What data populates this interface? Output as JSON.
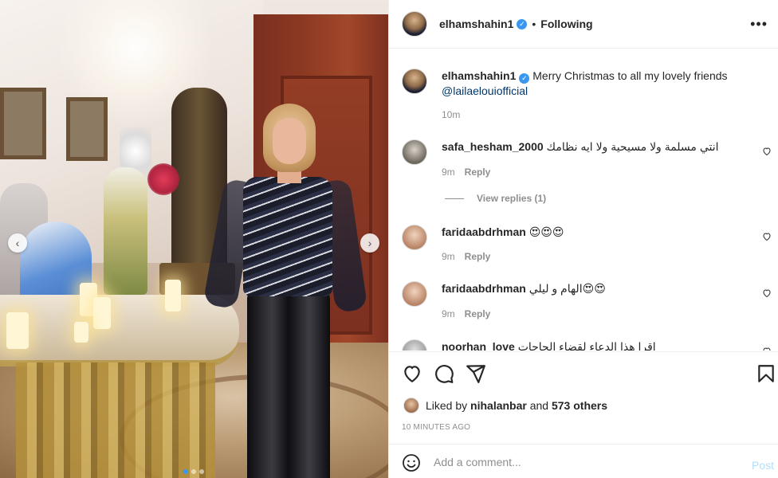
{
  "media": {
    "prev_glyph": "‹",
    "next_glyph": "›",
    "carousel_dots": 3,
    "active_dot": 1
  },
  "header": {
    "username": "elhamshahin1",
    "verified_glyph": "✓",
    "separator": "•",
    "follow_status": "Following",
    "more_glyph": "•••"
  },
  "caption": {
    "username": "elhamshahin1",
    "text": "Merry Christmas to all my lovely friends",
    "mention": "@lailaelouiofficial",
    "time": "10m"
  },
  "comments": [
    {
      "username": "safa_hesham_2000",
      "text": "انتي مسلمة ولا مسيحية ولا ايه نظامك",
      "time": "9m",
      "reply_label": "Reply",
      "view_replies": "View replies (1)"
    },
    {
      "username": "faridaabdrhman",
      "text": "😍😍😍",
      "time": "9m",
      "reply_label": "Reply"
    },
    {
      "username": "faridaabdrhman",
      "text": "الهام و ليلي😍😍",
      "time": "9m",
      "reply_label": "Reply"
    },
    {
      "username": "noorhan_love",
      "text": "اقرا هذا الدعاء لقضاء الحاجات"
    }
  ],
  "likes": {
    "prefix": "Liked by",
    "user": "nihalanbar",
    "middle": "and",
    "others": "573 others"
  },
  "timestamp": "10 MINUTES AGO",
  "add_comment": {
    "placeholder": "Add a comment...",
    "post_label": "Post"
  },
  "colors": {
    "verified": "#3897f0",
    "mention": "#00376b",
    "post_disabled": "#b2dffc",
    "secondary_text": "#8e8e8e"
  },
  "icons": [
    "chevron-left-icon",
    "chevron-right-icon",
    "verified-icon",
    "more-icon",
    "heart-icon",
    "comment-icon",
    "share-icon",
    "bookmark-icon",
    "emoji-icon"
  ]
}
